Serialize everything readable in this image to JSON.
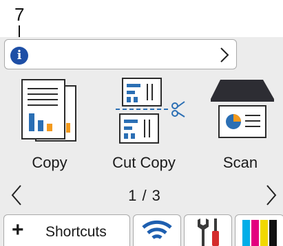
{
  "callout": {
    "number": "7"
  },
  "info_bar": {
    "icon": "info-icon",
    "glyph": "i",
    "chevron": "chevron-right-icon"
  },
  "tiles": [
    {
      "label": "Copy",
      "icon": "copy-document-icon"
    },
    {
      "label": "Cut Copy",
      "icon": "cut-copy-scissors-icon"
    },
    {
      "label": "Scan",
      "icon": "scanner-icon"
    }
  ],
  "pager": {
    "text": "1 / 3",
    "prev": "chevron-left-icon",
    "next": "chevron-right-icon"
  },
  "bottom_tabs": {
    "shortcuts": {
      "icon_glyph": "+",
      "label": "Shortcuts"
    },
    "wifi": "wifi-icon",
    "tools": "wrench-screwdriver-icon",
    "toner": {
      "icon": "toner-levels-icon",
      "colors": [
        "#00aee8",
        "#e3007f",
        "#f2d800",
        "#111111"
      ]
    }
  },
  "colors": {
    "accent": "#1e4fa6",
    "icon_blue": "#2b6fb4",
    "orange": "#f39a1e",
    "screen_bg": "#ececec"
  }
}
